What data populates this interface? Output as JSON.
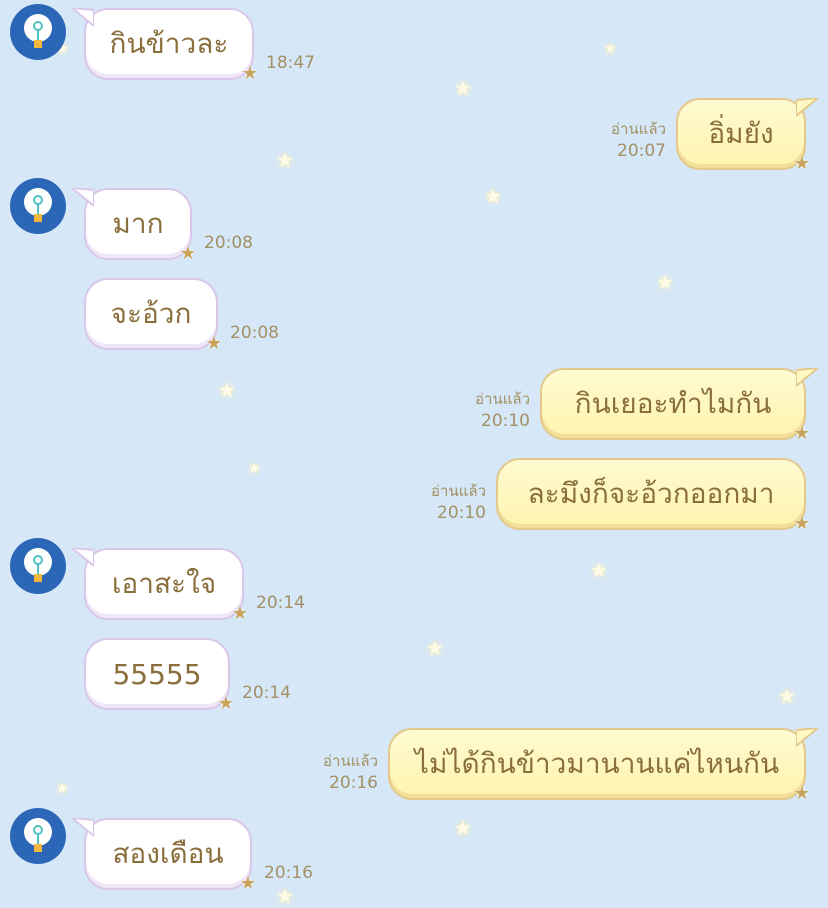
{
  "messages": [
    {
      "side": "in",
      "text": "กินข้าวละ",
      "time": "18:47"
    },
    {
      "side": "out",
      "text": "อิ่มยัง",
      "time": "20:07",
      "read": "อ่านแล้ว"
    },
    {
      "side": "in",
      "text": "มาก",
      "time": "20:08"
    },
    {
      "side": "in",
      "text": "จะอ้วก",
      "time": "20:08"
    },
    {
      "side": "out",
      "text": "กินเยอะทำไมกัน",
      "time": "20:10",
      "read": "อ่านแล้ว"
    },
    {
      "side": "out",
      "text": "ละมึงก็จะอ้วกออกมา",
      "time": "20:10",
      "read": "อ่านแล้ว"
    },
    {
      "side": "in",
      "text": "เอาสะใจ",
      "time": "20:14"
    },
    {
      "side": "in",
      "text": "55555",
      "time": "20:14"
    },
    {
      "side": "out",
      "text": "ไม่ได้กินข้าวมานานแค่ไหนกัน",
      "time": "20:16",
      "read": "อ่านแล้ว"
    },
    {
      "side": "in",
      "text": "สองเดือน",
      "time": "20:16"
    }
  ],
  "colors": {
    "background": "#d6e8f7",
    "incoming_bubble": "#ffffff",
    "outgoing_bubble": "#fff5b8",
    "text": "#8a6f3c",
    "meta_text": "#a39066",
    "avatar": "#2c66b7"
  },
  "icons": {
    "avatar": "lightbulb-icon",
    "bubble_decoration": "star-icon"
  }
}
